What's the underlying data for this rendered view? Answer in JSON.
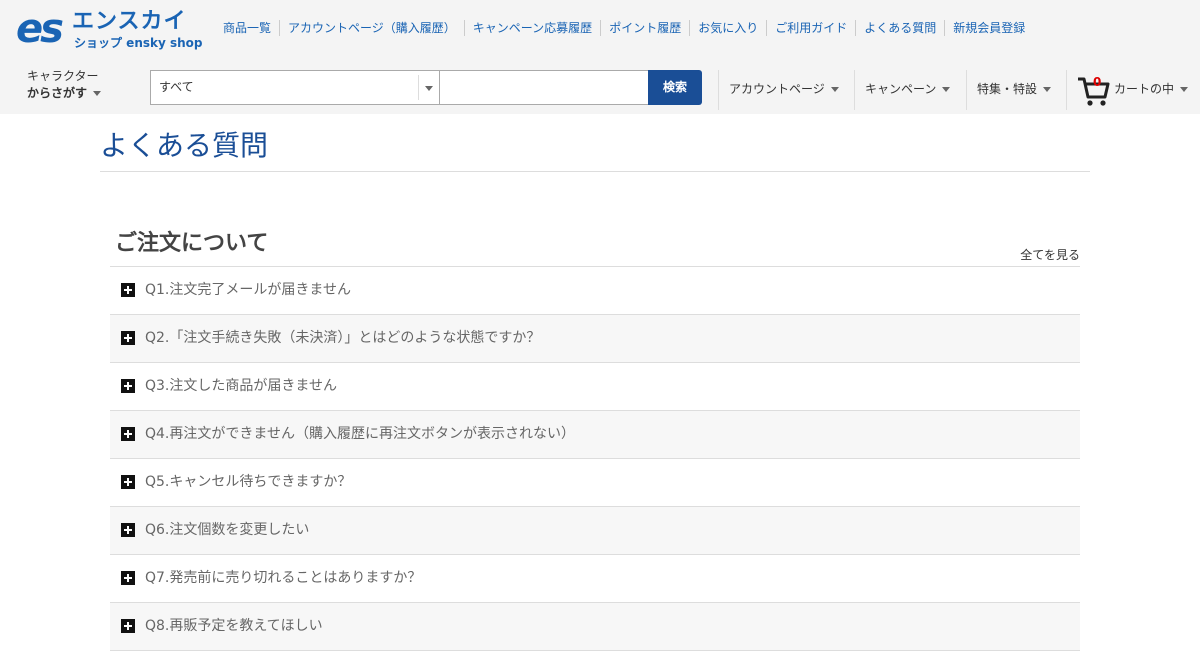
{
  "brand": {
    "logo_mark": "es",
    "name_jp": "エンスカイ",
    "sub": "ショップ ensky shop"
  },
  "topnav": [
    "商品一覧",
    "アカウントページ（購入履歴）",
    "キャンペーン応募履歴",
    "ポイント履歴",
    "お気に入り",
    "ご利用ガイド",
    "よくある質問",
    "新規会員登録"
  ],
  "character": {
    "line1": "キャラクター",
    "line2": "からさがす"
  },
  "search": {
    "category": "すべて",
    "placeholder": "",
    "button": "検索"
  },
  "menus": {
    "account": "アカウントページ",
    "campaign": "キャンペーン",
    "feature": "特集・特設"
  },
  "cart": {
    "count": "0",
    "label": "カートの中"
  },
  "page_title": "よくある質問",
  "section": {
    "title": "ご注文について",
    "see_all": "全てを見る"
  },
  "faqs": [
    "Q1.注文完了メールが届きません",
    "Q2.「注文手続き失敗（未決済）」とはどのような状態ですか？",
    "Q3.注文した商品が届きません",
    "Q4.再注文ができません（購入履歴に再注文ボタンが表示されない）",
    "Q5.キャンセル待ちできますか？",
    "Q6.注文個数を変更したい",
    "Q7.発売前に売り切れることはありますか？",
    "Q8.再販予定を教えてほしい"
  ],
  "colors": {
    "brand_blue": "#1a64b4",
    "button_navy": "#1a4e96",
    "cart_count": "#dd0000"
  }
}
